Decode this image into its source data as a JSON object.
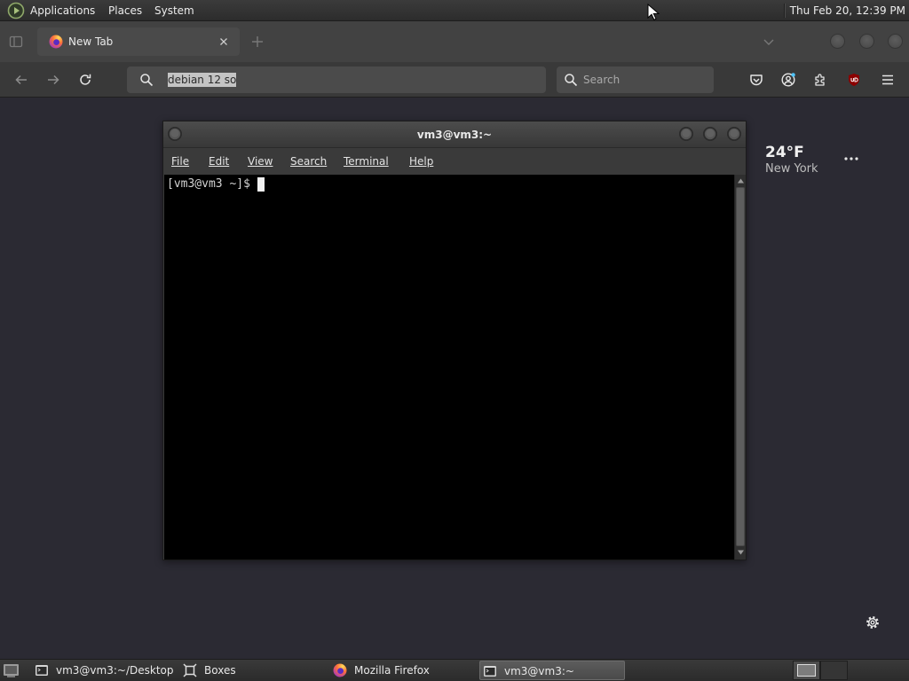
{
  "top_panel": {
    "logo_icon": "mate-menu-icon",
    "menus": [
      {
        "label": "Applications"
      },
      {
        "label": "Places"
      },
      {
        "label": "System"
      }
    ],
    "clock": "Thu Feb 20, 12:39 PM"
  },
  "browser": {
    "tabs": [
      {
        "title": "New Tab",
        "icon": "firefox-icon",
        "active": true
      }
    ],
    "address_bar": {
      "value": "debian 12 so",
      "selected": true
    },
    "search_bar": {
      "placeholder": "Search"
    },
    "toolbar_icons": [
      "back-icon",
      "forward-icon",
      "reload-icon",
      "pocket-icon",
      "account-icon",
      "extensions-icon",
      "ublock-icon",
      "menu-icon"
    ]
  },
  "new_tab_page": {
    "weather": {
      "temperature": "24°F",
      "location": "New York"
    },
    "weather_menu_icon": "more-horizontal-icon",
    "settings_icon": "gear-icon"
  },
  "terminal": {
    "title": "vm3@vm3:~",
    "menu": [
      "File",
      "Edit",
      "View",
      "Search",
      "Terminal",
      "Help"
    ],
    "prompt": "[vm3@vm3 ~]$"
  },
  "taskbar": {
    "tasks": [
      {
        "label": "vm3@vm3:~/Desktop",
        "icon": "terminal-icon",
        "active": false
      },
      {
        "label": "Boxes",
        "icon": "boxes-icon",
        "active": false
      },
      {
        "label": "Mozilla Firefox",
        "icon": "firefox-icon",
        "active": false
      },
      {
        "label": "vm3@vm3:~",
        "icon": "terminal-icon",
        "active": true
      }
    ],
    "workspaces": {
      "count": 2,
      "active": 1
    }
  },
  "colors": {
    "content_background": "#2b2a33",
    "selection": "#c4c4c4",
    "terminal_background": "#000000",
    "terminal_text": "#d3d3d3",
    "account_badge": "#4fc3f7",
    "ublock_red": "#8b0000"
  }
}
